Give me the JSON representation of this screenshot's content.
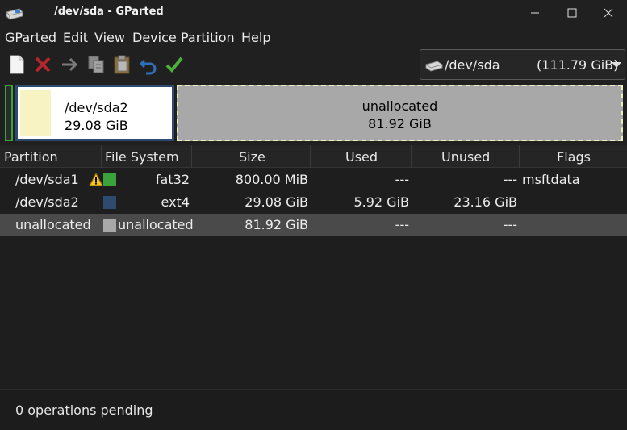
{
  "window": {
    "title": "/dev/sda - GParted"
  },
  "menu": [
    "GParted",
    "Edit",
    "View",
    "Device",
    "Partition",
    "Help"
  ],
  "toolbar": {
    "buttons": [
      "new-icon",
      "delete-icon",
      "resize-move-icon",
      "copy-icon",
      "paste-icon",
      "undo-icon",
      "apply-icon"
    ],
    "device": {
      "name": "/dev/sda",
      "size": "(111.79 GiB)"
    }
  },
  "graph": {
    "sda2": {
      "name": "/dev/sda2",
      "size": "29.08 GiB"
    },
    "unallocated": {
      "name": "unallocated",
      "size": "81.92 GiB"
    }
  },
  "table": {
    "headers": [
      "Partition",
      "File System",
      "Size",
      "Used",
      "Unused",
      "Flags"
    ],
    "rows": [
      {
        "partition": "/dev/sda1",
        "filesystem": "fat32",
        "size": "800.00 MiB",
        "used": "---",
        "unused": "---",
        "flags": "msftdata",
        "color": "#3aa33a",
        "warning": true
      },
      {
        "partition": "/dev/sda2",
        "filesystem": "ext4",
        "size": "29.08 GiB",
        "used": "5.92 GiB",
        "unused": "23.16 GiB",
        "flags": "",
        "color": "#2e4a6e",
        "warning": false
      },
      {
        "partition": "unallocated",
        "filesystem": "unallocated",
        "size": "81.92 GiB",
        "used": "---",
        "unused": "---",
        "flags": "",
        "color": "#a8a8a8",
        "warning": false
      }
    ]
  },
  "status": {
    "text": "0 operations pending"
  },
  "colors": {
    "fat32": "#3aa33a",
    "ext4": "#2e4a6e",
    "unallocated": "#a8a8a8",
    "used_space": "#f7f3c2",
    "selected_row": "#4a4a4a"
  }
}
